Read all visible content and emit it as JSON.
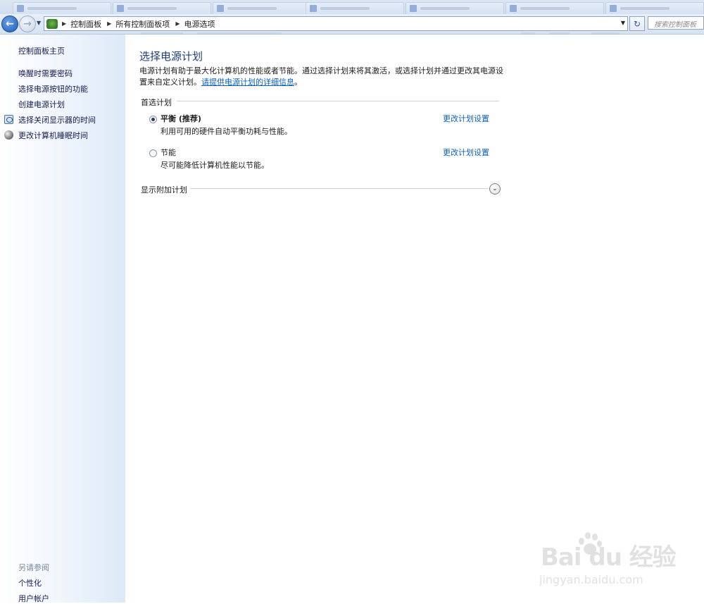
{
  "window": {
    "tabs": [
      "",
      "",
      "",
      "",
      "",
      "",
      "",
      ""
    ]
  },
  "addressbar": {
    "breadcrumbs": [
      "控制面板",
      "所有控制面板项",
      "电源选项"
    ],
    "search_placeholder": "搜索控制面板"
  },
  "sidebar": {
    "home": "控制面板主页",
    "items": [
      {
        "label": "唤醒时需要密码",
        "icon": ""
      },
      {
        "label": "选择电源按钮的功能",
        "icon": ""
      },
      {
        "label": "创建电源计划",
        "icon": ""
      },
      {
        "label": "选择关闭显示器的时间",
        "icon": "monitor-icon"
      },
      {
        "label": "更改计算机睡眠时间",
        "icon": "moon-icon"
      }
    ],
    "see_also_title": "另请参阅",
    "see_also": [
      "个性化",
      "用户帐户"
    ]
  },
  "main": {
    "title": "选择电源计划",
    "description": "电源计划有助于最大化计算机的性能或者节能。通过选择计划来将其激活，或选择计划并通过更改其电源设置来自定义计划。",
    "description_link": "请提供电源计划的详细信息",
    "description_end": "。",
    "preferred_heading": "首选计划",
    "plans": [
      {
        "name": "平衡 (推荐)",
        "desc": "利用可用的硬件自动平衡功耗与性能。",
        "selected": true,
        "link": "更改计划设置"
      },
      {
        "name": "节能",
        "desc": "尽可能降低计算机性能以节能。",
        "selected": false,
        "link": "更改计划设置"
      }
    ],
    "additional_heading": "显示附加计划"
  },
  "watermark": {
    "logo": "Bai du 经验",
    "url": "jingyan.baidu.com"
  },
  "colors": {
    "link": "#0a60c0",
    "title": "#1f3f7a",
    "sidebar_link": "#151c55"
  }
}
